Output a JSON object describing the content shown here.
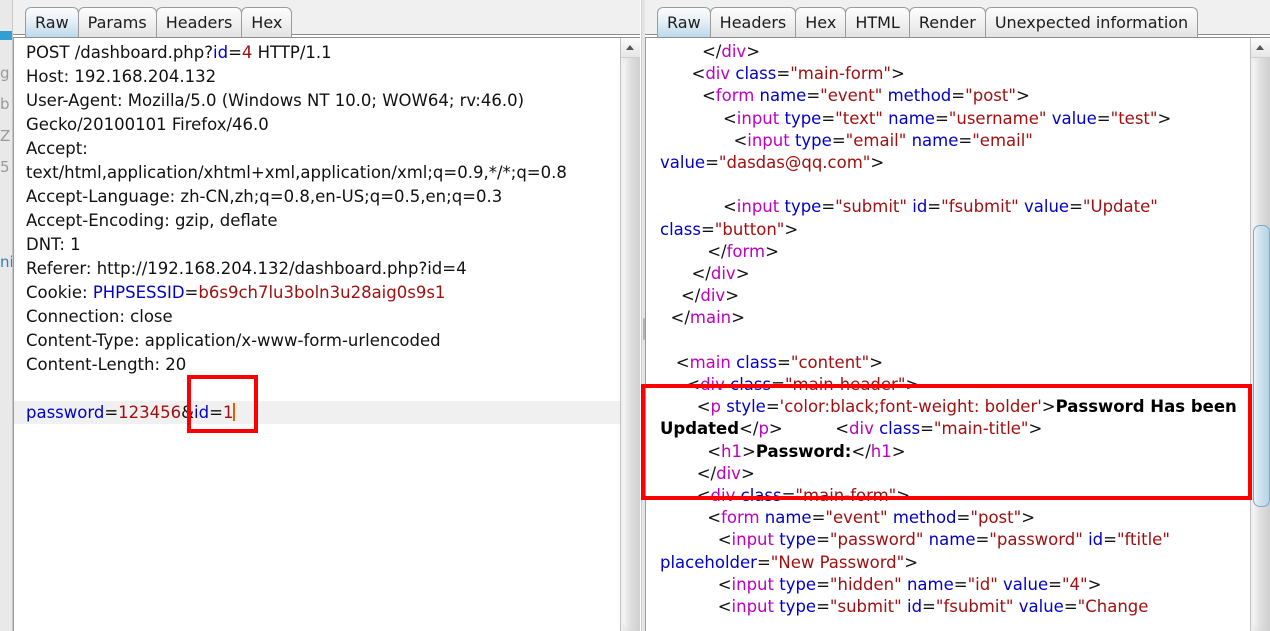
{
  "left_strip": {
    "ghost_fragments": [
      "g",
      "b",
      "Z",
      "5",
      "ni"
    ]
  },
  "request_panel": {
    "name": "HTTP request editor",
    "tabs": [
      {
        "label": "Raw",
        "active": true
      },
      {
        "label": "Params",
        "active": false
      },
      {
        "label": "Headers",
        "active": false
      },
      {
        "label": "Hex",
        "active": false
      }
    ],
    "raw_lines": [
      {
        "parts": [
          {
            "t": "POST /dashboard.php?",
            "c": "k-punct"
          },
          {
            "t": "id",
            "c": "k-name"
          },
          {
            "t": "=",
            "c": "k-punct"
          },
          {
            "t": "4",
            "c": "k-val"
          },
          {
            "t": " HTTP/1.1",
            "c": "k-punct"
          }
        ]
      },
      {
        "parts": [
          {
            "t": "Host: 192.168.204.132",
            "c": "k-punct"
          }
        ]
      },
      {
        "parts": [
          {
            "t": "User-Agent: Mozilla/5.0 (Windows NT 10.0; WOW64; rv:46.0)",
            "c": "k-punct"
          }
        ]
      },
      {
        "parts": [
          {
            "t": "Gecko/20100101 Firefox/46.0",
            "c": "k-punct"
          }
        ]
      },
      {
        "parts": [
          {
            "t": "Accept:",
            "c": "k-punct"
          }
        ]
      },
      {
        "parts": [
          {
            "t": "text/html,application/xhtml+xml,application/xml;q=0.9,*/*;q=0.8",
            "c": "k-punct"
          }
        ]
      },
      {
        "parts": [
          {
            "t": "Accept-Language: zh-CN,zh;q=0.8,en-US;q=0.5,en;q=0.3",
            "c": "k-punct"
          }
        ]
      },
      {
        "parts": [
          {
            "t": "Accept-Encoding: gzip, deflate",
            "c": "k-punct"
          }
        ]
      },
      {
        "parts": [
          {
            "t": "DNT: 1",
            "c": "k-punct"
          }
        ]
      },
      {
        "parts": [
          {
            "t": "Referer: http://192.168.204.132/dashboard.php?id=4",
            "c": "k-punct"
          }
        ]
      },
      {
        "parts": [
          {
            "t": "Cookie: ",
            "c": "k-punct"
          },
          {
            "t": "PHPSESSID",
            "c": "k-name"
          },
          {
            "t": "=",
            "c": "k-punct"
          },
          {
            "t": "b6s9ch7lu3boln3u28aig0s9s1",
            "c": "k-val"
          }
        ]
      },
      {
        "parts": [
          {
            "t": "Connection: close",
            "c": "k-punct"
          }
        ]
      },
      {
        "parts": [
          {
            "t": "Content-Type: application/x-www-form-urlencoded",
            "c": "k-punct"
          }
        ]
      },
      {
        "parts": [
          {
            "t": "Content-Length: 20",
            "c": "k-punct"
          }
        ]
      },
      {
        "parts": [
          {
            "t": "",
            "c": "k-punct"
          }
        ]
      },
      {
        "highlight": true,
        "caret": true,
        "parts": [
          {
            "t": "password",
            "c": "k-name"
          },
          {
            "t": "=",
            "c": "k-punct"
          },
          {
            "t": "123456",
            "c": "k-val"
          },
          {
            "t": "&",
            "c": "k-punct"
          },
          {
            "t": "id",
            "c": "k-name"
          },
          {
            "t": "=",
            "c": "k-punct"
          },
          {
            "t": "1",
            "c": "k-val"
          }
        ]
      }
    ],
    "annotation": {
      "name": "red-highlight-box-id-param"
    }
  },
  "response_panel": {
    "name": "HTTP response viewer",
    "tabs": [
      {
        "label": "Raw",
        "active": true
      },
      {
        "label": "Headers",
        "active": false
      },
      {
        "label": "Hex",
        "active": false
      },
      {
        "label": "HTML",
        "active": false
      },
      {
        "label": "Render",
        "active": false
      },
      {
        "label": "Unexpected information",
        "active": false
      }
    ],
    "raw_lines": [
      {
        "parts": [
          {
            "t": "        </",
            "c": "k-punct"
          },
          {
            "t": "div",
            "c": "k-tag"
          },
          {
            "t": ">",
            "c": "k-punct"
          }
        ]
      },
      {
        "parts": [
          {
            "t": "      <",
            "c": "k-punct"
          },
          {
            "t": "div ",
            "c": "k-tag"
          },
          {
            "t": "class",
            "c": "k-name"
          },
          {
            "t": "=",
            "c": "k-punct"
          },
          {
            "t": "\"main-form\"",
            "c": "k-val"
          },
          {
            "t": ">",
            "c": "k-punct"
          }
        ]
      },
      {
        "parts": [
          {
            "t": "        <",
            "c": "k-punct"
          },
          {
            "t": "form ",
            "c": "k-tag"
          },
          {
            "t": "name",
            "c": "k-name"
          },
          {
            "t": "=",
            "c": "k-punct"
          },
          {
            "t": "\"event\" ",
            "c": "k-val"
          },
          {
            "t": "method",
            "c": "k-name"
          },
          {
            "t": "=",
            "c": "k-punct"
          },
          {
            "t": "\"post\"",
            "c": "k-val"
          },
          {
            "t": ">",
            "c": "k-punct"
          }
        ]
      },
      {
        "parts": [
          {
            "t": "            <",
            "c": "k-punct"
          },
          {
            "t": "input ",
            "c": "k-tag"
          },
          {
            "t": "type",
            "c": "k-name"
          },
          {
            "t": "=",
            "c": "k-punct"
          },
          {
            "t": "\"text\" ",
            "c": "k-val"
          },
          {
            "t": "name",
            "c": "k-name"
          },
          {
            "t": "=",
            "c": "k-punct"
          },
          {
            "t": "\"username\" ",
            "c": "k-val"
          },
          {
            "t": "value",
            "c": "k-name"
          },
          {
            "t": "=",
            "c": "k-punct"
          },
          {
            "t": "\"test\"",
            "c": "k-val"
          },
          {
            "t": ">",
            "c": "k-punct"
          }
        ]
      },
      {
        "parts": [
          {
            "t": "              <",
            "c": "k-punct"
          },
          {
            "t": "input ",
            "c": "k-tag"
          },
          {
            "t": "type",
            "c": "k-name"
          },
          {
            "t": "=",
            "c": "k-punct"
          },
          {
            "t": "\"email\" ",
            "c": "k-val"
          },
          {
            "t": "name",
            "c": "k-name"
          },
          {
            "t": "=",
            "c": "k-punct"
          },
          {
            "t": "\"email\"\n",
            "c": "k-val"
          },
          {
            "t": "value",
            "c": "k-name"
          },
          {
            "t": "=",
            "c": "k-punct"
          },
          {
            "t": "\"dasdas@qq.com\"",
            "c": "k-val"
          },
          {
            "t": ">",
            "c": "k-punct"
          }
        ]
      },
      {
        "parts": [
          {
            "t": "",
            "c": "k-punct"
          }
        ]
      },
      {
        "parts": [
          {
            "t": "            <",
            "c": "k-punct"
          },
          {
            "t": "input ",
            "c": "k-tag"
          },
          {
            "t": "type",
            "c": "k-name"
          },
          {
            "t": "=",
            "c": "k-punct"
          },
          {
            "t": "\"submit\" ",
            "c": "k-val"
          },
          {
            "t": "id",
            "c": "k-name"
          },
          {
            "t": "=",
            "c": "k-punct"
          },
          {
            "t": "\"fsubmit\" ",
            "c": "k-val"
          },
          {
            "t": "value",
            "c": "k-name"
          },
          {
            "t": "=",
            "c": "k-punct"
          },
          {
            "t": "\"Update\"\n",
            "c": "k-val"
          },
          {
            "t": "class",
            "c": "k-name"
          },
          {
            "t": "=",
            "c": "k-punct"
          },
          {
            "t": "\"button\"",
            "c": "k-val"
          },
          {
            "t": ">",
            "c": "k-punct"
          }
        ]
      },
      {
        "parts": [
          {
            "t": "         </",
            "c": "k-punct"
          },
          {
            "t": "form",
            "c": "k-tag"
          },
          {
            "t": ">",
            "c": "k-punct"
          }
        ]
      },
      {
        "parts": [
          {
            "t": "      </",
            "c": "k-punct"
          },
          {
            "t": "div",
            "c": "k-tag"
          },
          {
            "t": ">",
            "c": "k-punct"
          }
        ]
      },
      {
        "parts": [
          {
            "t": "    </",
            "c": "k-punct"
          },
          {
            "t": "div",
            "c": "k-tag"
          },
          {
            "t": ">",
            "c": "k-punct"
          }
        ]
      },
      {
        "parts": [
          {
            "t": "  </",
            "c": "k-punct"
          },
          {
            "t": "main",
            "c": "k-tag"
          },
          {
            "t": ">",
            "c": "k-punct"
          }
        ]
      },
      {
        "parts": [
          {
            "t": "",
            "c": "k-punct"
          }
        ]
      },
      {
        "parts": [
          {
            "t": "   <",
            "c": "k-punct"
          },
          {
            "t": "main ",
            "c": "k-tag"
          },
          {
            "t": "class",
            "c": "k-name"
          },
          {
            "t": "=",
            "c": "k-punct"
          },
          {
            "t": "\"content\"",
            "c": "k-val"
          },
          {
            "t": ">",
            "c": "k-punct"
          }
        ]
      },
      {
        "parts": [
          {
            "t": "     <",
            "c": "k-punct"
          },
          {
            "t": "div ",
            "c": "k-tag"
          },
          {
            "t": "class",
            "c": "k-name"
          },
          {
            "t": "=",
            "c": "k-punct"
          },
          {
            "t": "\"main-header\"",
            "c": "k-val"
          },
          {
            "t": ">",
            "c": "k-punct"
          }
        ]
      },
      {
        "parts": [
          {
            "t": "       <",
            "c": "k-punct"
          },
          {
            "t": "p ",
            "c": "k-tag"
          },
          {
            "t": "style",
            "c": "k-name"
          },
          {
            "t": "=",
            "c": "k-punct"
          },
          {
            "t": "'color:black;font-weight: bolder'",
            "c": "k-val"
          },
          {
            "t": ">",
            "c": "k-punct"
          },
          {
            "t": "Password Has been\nUpdated",
            "c": "k-bold"
          },
          {
            "t": "</",
            "c": "k-punct"
          },
          {
            "t": "p",
            "c": "k-tag"
          },
          {
            "t": ">",
            "c": "k-punct"
          },
          {
            "t": "          <",
            "c": "k-punct"
          },
          {
            "t": "div ",
            "c": "k-tag"
          },
          {
            "t": "class",
            "c": "k-name"
          },
          {
            "t": "=",
            "c": "k-punct"
          },
          {
            "t": "\"main-title\"",
            "c": "k-val"
          },
          {
            "t": ">",
            "c": "k-punct"
          }
        ]
      },
      {
        "parts": [
          {
            "t": "         <",
            "c": "k-punct"
          },
          {
            "t": "h1",
            "c": "k-tag"
          },
          {
            "t": ">",
            "c": "k-punct"
          },
          {
            "t": "Password:",
            "c": "k-bold"
          },
          {
            "t": "</",
            "c": "k-punct"
          },
          {
            "t": "h1",
            "c": "k-tag"
          },
          {
            "t": ">",
            "c": "k-punct"
          }
        ]
      },
      {
        "parts": [
          {
            "t": "       </",
            "c": "k-punct"
          },
          {
            "t": "div",
            "c": "k-tag"
          },
          {
            "t": ">",
            "c": "k-punct"
          }
        ]
      },
      {
        "parts": [
          {
            "t": "       <",
            "c": "k-punct"
          },
          {
            "t": "div ",
            "c": "k-tag"
          },
          {
            "t": "class",
            "c": "k-name"
          },
          {
            "t": "=",
            "c": "k-punct"
          },
          {
            "t": "\"main-form\"",
            "c": "k-val"
          },
          {
            "t": ">",
            "c": "k-punct"
          }
        ]
      },
      {
        "parts": [
          {
            "t": "         <",
            "c": "k-punct"
          },
          {
            "t": "form ",
            "c": "k-tag"
          },
          {
            "t": "name",
            "c": "k-name"
          },
          {
            "t": "=",
            "c": "k-punct"
          },
          {
            "t": "\"event\" ",
            "c": "k-val"
          },
          {
            "t": "method",
            "c": "k-name"
          },
          {
            "t": "=",
            "c": "k-punct"
          },
          {
            "t": "\"post\"",
            "c": "k-val"
          },
          {
            "t": ">",
            "c": "k-punct"
          }
        ]
      },
      {
        "parts": [
          {
            "t": "           <",
            "c": "k-punct"
          },
          {
            "t": "input ",
            "c": "k-tag"
          },
          {
            "t": "type",
            "c": "k-name"
          },
          {
            "t": "=",
            "c": "k-punct"
          },
          {
            "t": "\"password\" ",
            "c": "k-val"
          },
          {
            "t": "name",
            "c": "k-name"
          },
          {
            "t": "=",
            "c": "k-punct"
          },
          {
            "t": "\"password\" ",
            "c": "k-val"
          },
          {
            "t": "id",
            "c": "k-name"
          },
          {
            "t": "=",
            "c": "k-punct"
          },
          {
            "t": "\"ftitle\"\n",
            "c": "k-val"
          },
          {
            "t": "placeholder",
            "c": "k-name"
          },
          {
            "t": "=",
            "c": "k-punct"
          },
          {
            "t": "\"New Password\"",
            "c": "k-val"
          },
          {
            "t": ">",
            "c": "k-punct"
          }
        ]
      },
      {
        "parts": [
          {
            "t": "           <",
            "c": "k-punct"
          },
          {
            "t": "input ",
            "c": "k-tag"
          },
          {
            "t": "type",
            "c": "k-name"
          },
          {
            "t": "=",
            "c": "k-punct"
          },
          {
            "t": "\"hidden\" ",
            "c": "k-val"
          },
          {
            "t": "name",
            "c": "k-name"
          },
          {
            "t": "=",
            "c": "k-punct"
          },
          {
            "t": "\"id\" ",
            "c": "k-val"
          },
          {
            "t": "value",
            "c": "k-name"
          },
          {
            "t": "=",
            "c": "k-punct"
          },
          {
            "t": "\"4\"",
            "c": "k-val"
          },
          {
            "t": ">",
            "c": "k-punct"
          }
        ]
      },
      {
        "parts": [
          {
            "t": "           <",
            "c": "k-punct"
          },
          {
            "t": "input ",
            "c": "k-tag"
          },
          {
            "t": "type",
            "c": "k-name"
          },
          {
            "t": "=",
            "c": "k-punct"
          },
          {
            "t": "\"submit\" ",
            "c": "k-val"
          },
          {
            "t": "id",
            "c": "k-name"
          },
          {
            "t": "=",
            "c": "k-punct"
          },
          {
            "t": "\"fsubmit\" ",
            "c": "k-val"
          },
          {
            "t": "value",
            "c": "k-name"
          },
          {
            "t": "=",
            "c": "k-punct"
          },
          {
            "t": "\"Change",
            "c": "k-val"
          }
        ]
      }
    ],
    "annotation": {
      "name": "red-highlight-box-password-updated"
    }
  },
  "colors": {
    "annotation_red": "#fb0000",
    "attr_name_blue": "#0000c8",
    "attr_value_red": "#a01010",
    "tag_magenta": "#c000c0",
    "caret_orange": "#e06000",
    "active_tab_blue": "#bcd9ea",
    "highlight_row": "#f0f0f0"
  }
}
